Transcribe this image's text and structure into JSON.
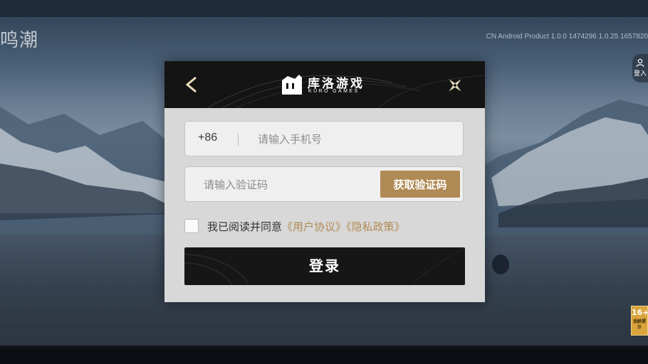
{
  "background": {
    "game_logo": "鸣潮",
    "version": "CN Android Product 1.0.0 1474296 1.0.25 1657820",
    "account_button_label": "登入",
    "age_rating": "16+",
    "age_rating_note": "适龄提示"
  },
  "dialog": {
    "brand_cn": "库洛游戏",
    "brand_en": "KURO GAMES",
    "phone": {
      "prefix": "+86",
      "placeholder": "请输入手机号",
      "value": ""
    },
    "code": {
      "placeholder": "请输入验证码",
      "value": "",
      "button_label": "获取验证码"
    },
    "agreement": {
      "checked": false,
      "text": "我已阅读并同意",
      "user_agreement": "《用户协议》",
      "privacy_policy": "《隐私政策》"
    },
    "login_label": "登录"
  },
  "colors": {
    "accent_gold": "#b08a55",
    "header_black": "#141414",
    "dialog_bg": "#d8d8d8"
  }
}
